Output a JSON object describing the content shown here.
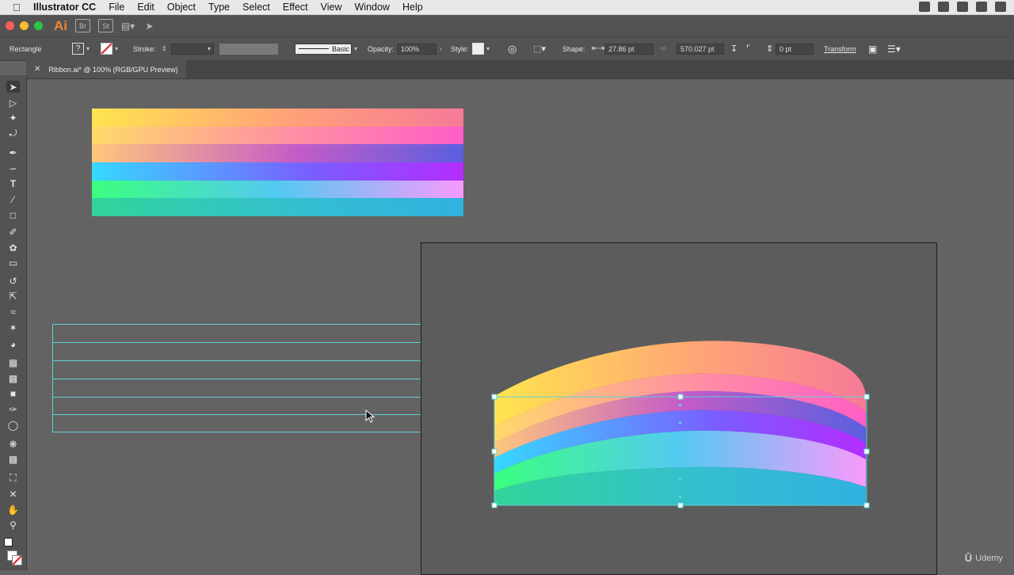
{
  "menubar": {
    "app_name": "Illustrator CC",
    "items": [
      "File",
      "Edit",
      "Object",
      "Type",
      "Select",
      "Effect",
      "View",
      "Window",
      "Help"
    ]
  },
  "appbar": {
    "logo": "Ai",
    "icons": [
      "Br",
      "St"
    ]
  },
  "controlbar": {
    "selection_type": "Rectangle",
    "stroke_label": "Stroke:",
    "stroke_style": "Basic",
    "opacity_label": "Opacity:",
    "opacity_value": "100%",
    "style_label": "Style:",
    "shape_label": "Shape:",
    "width_value": "27.86 pt",
    "height_value": "570.027 pt",
    "corner_value": "0 pt",
    "transform_label": "Transform"
  },
  "document": {
    "tab_title": "Ribbon.ai* @ 100% (RGB/GPU Preview)"
  },
  "watermark": {
    "text": "Udemy"
  },
  "colors": {
    "selection": "#5fd0d6",
    "ui_dark": "#535353",
    "canvas": "#636363"
  },
  "icons": [
    "apple-icon",
    "dropbox-icon",
    "close-icon",
    "fill-icon",
    "stroke-none-icon",
    "selection-tool-icon",
    "direct-selection-tool-icon",
    "magic-wand-icon",
    "lasso-icon",
    "pen-tool-icon",
    "curvature-tool-icon",
    "type-tool-icon",
    "line-tool-icon",
    "rectangle-tool-icon",
    "paintbrush-icon",
    "shaper-tool-icon",
    "eraser-icon",
    "rotate-icon",
    "scale-icon",
    "width-tool-icon",
    "puppet-warp-icon",
    "shape-builder-icon",
    "perspective-grid-icon",
    "mesh-icon",
    "gradient-icon",
    "eyedropper-icon",
    "blend-icon",
    "symbol-sprayer-icon",
    "graph-icon",
    "artboard-icon",
    "slice-icon",
    "hand-icon",
    "zoom-icon",
    "cursor-icon"
  ]
}
